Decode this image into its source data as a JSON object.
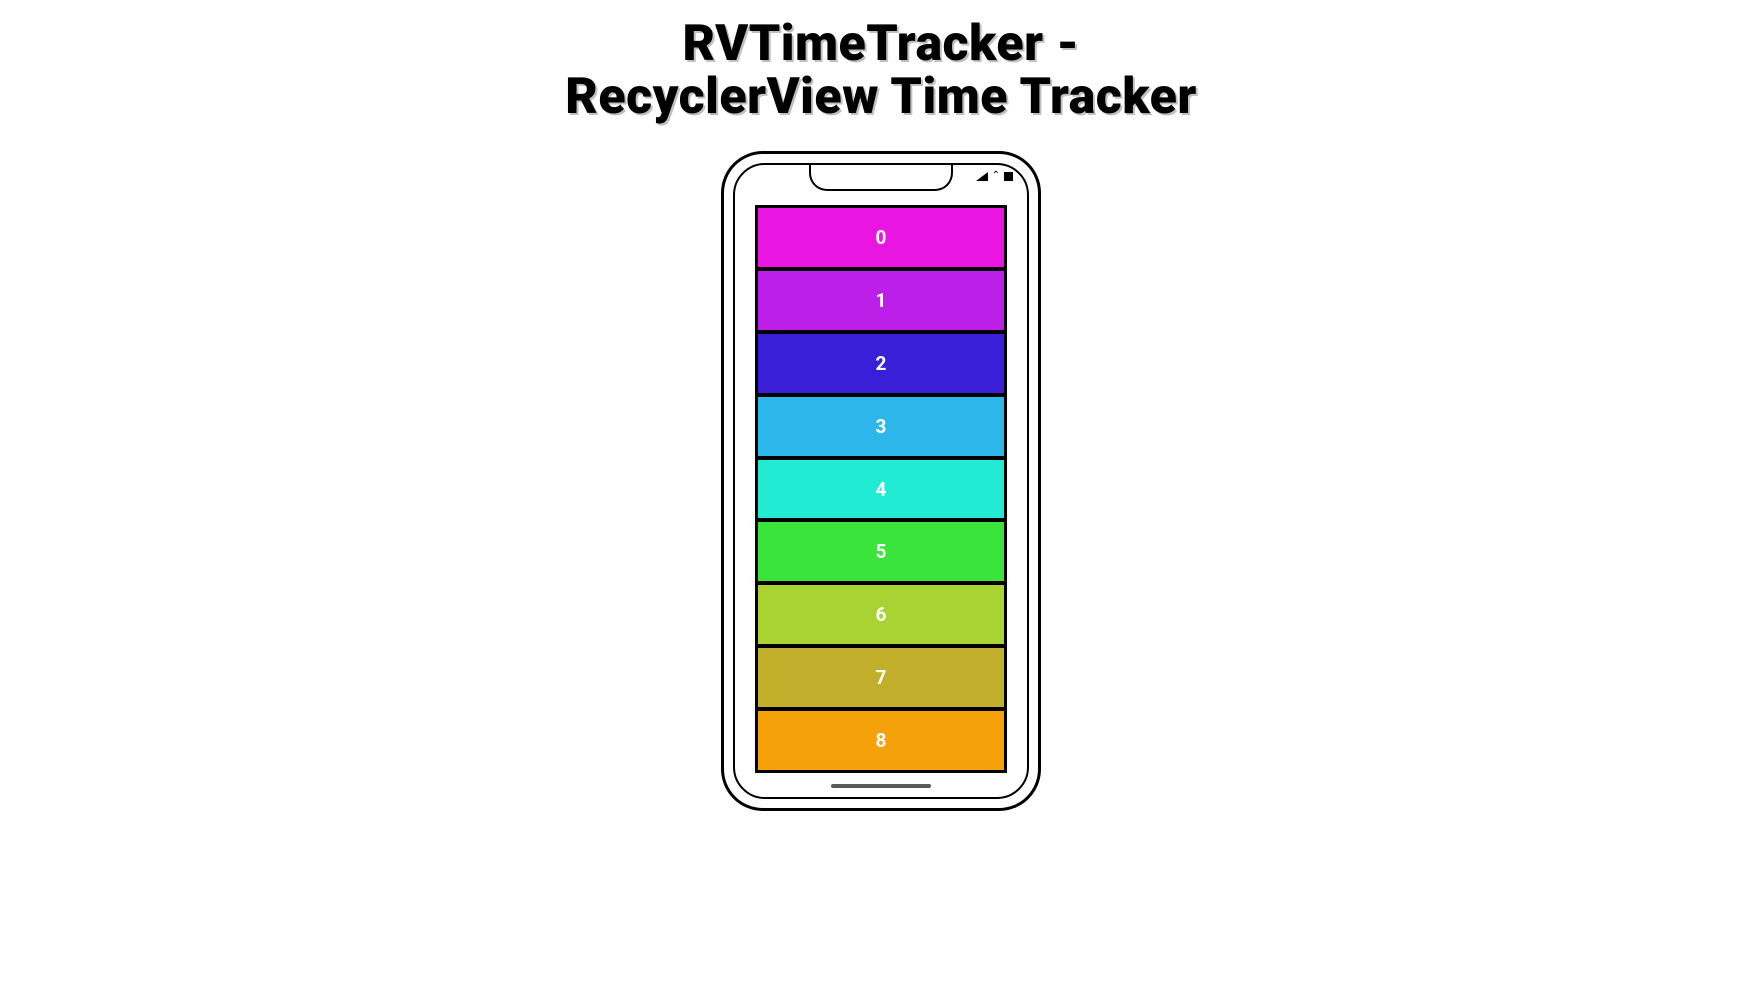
{
  "title_line1": "RVTimeTracker -",
  "title_line2": "RecyclerView Time Tracker",
  "rows": [
    {
      "label": "0",
      "color": "#E816E0"
    },
    {
      "label": "1",
      "color": "#BC1FE8"
    },
    {
      "label": "2",
      "color": "#3B1FD8"
    },
    {
      "label": "3",
      "color": "#2DB6EA"
    },
    {
      "label": "4",
      "color": "#22EBD4"
    },
    {
      "label": "5",
      "color": "#3BE43B"
    },
    {
      "label": "6",
      "color": "#A8D333"
    },
    {
      "label": "7",
      "color": "#C2B02C"
    },
    {
      "label": "8",
      "color": "#F5A20A"
    }
  ]
}
